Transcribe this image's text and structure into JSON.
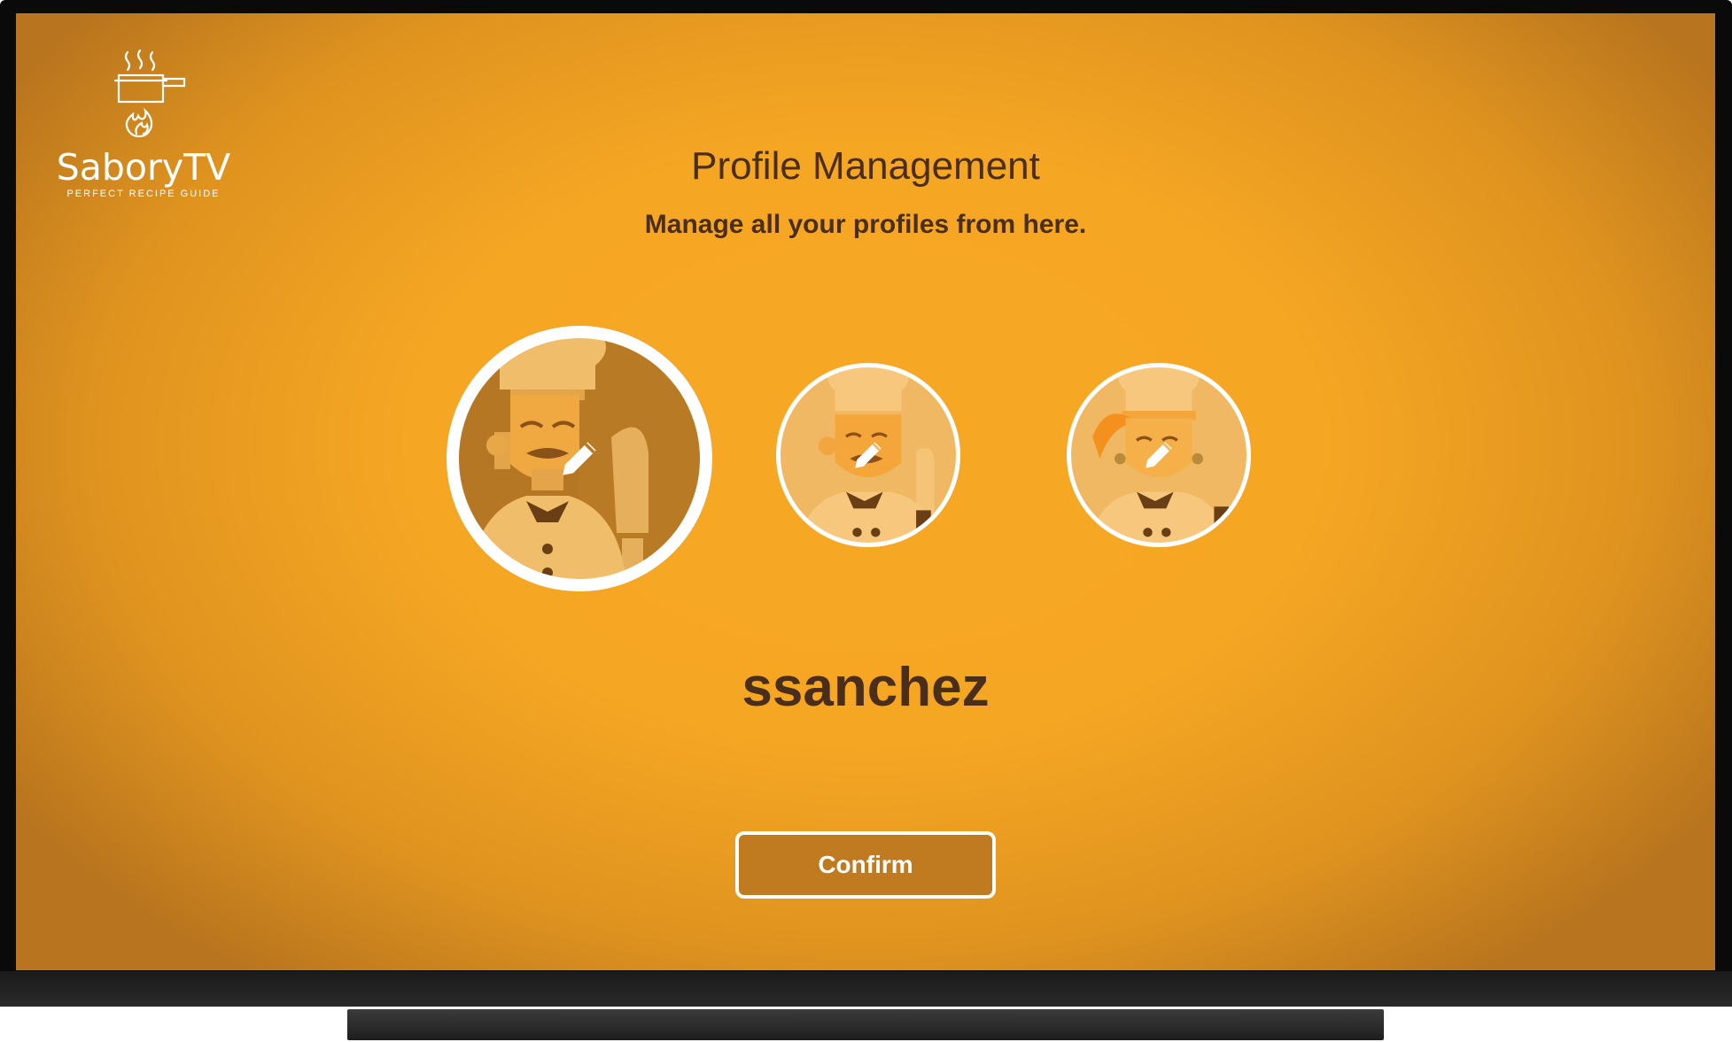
{
  "app": {
    "name": "SaboryTV",
    "tagline": "PERFECT RECIPE GUIDE"
  },
  "page": {
    "title": "Profile Management",
    "subtitle": "Manage all your profiles from here."
  },
  "profiles": [
    {
      "selected": true,
      "icon": "pencil-icon"
    },
    {
      "selected": false,
      "icon": "pencil-icon"
    },
    {
      "selected": false,
      "icon": "pencil-icon"
    }
  ],
  "selected_profile": {
    "username": "ssanchez"
  },
  "actions": {
    "confirm_label": "Confirm"
  },
  "colors": {
    "background": "#f5a623",
    "text_dark": "#4a2e1a",
    "button": "#c07a1f"
  }
}
